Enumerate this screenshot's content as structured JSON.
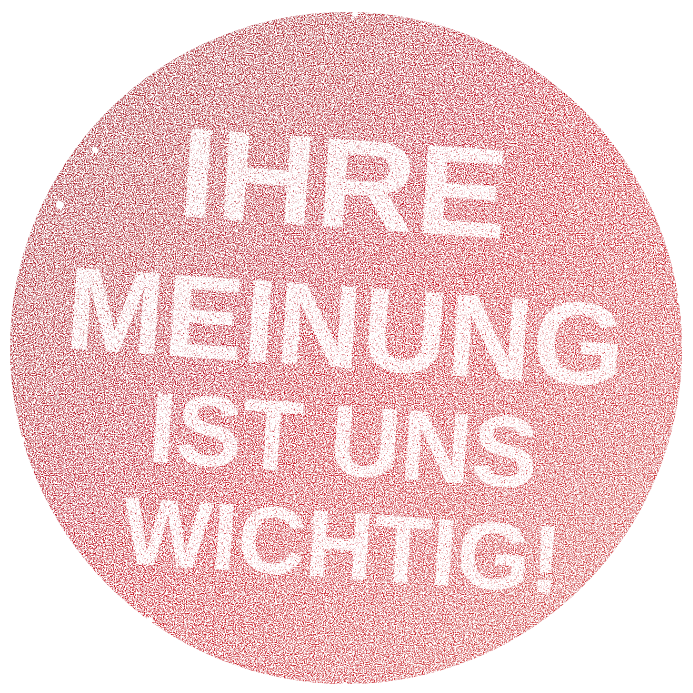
{
  "stamp": {
    "lines": [
      "IHRE",
      "MEINUNG",
      "IST UNS",
      "WICHTIG!"
    ]
  },
  "colors": {
    "stamp_light": "#e01a2c",
    "stamp_mid": "#c8101e",
    "stamp_dark": "#9a1426",
    "stamp_edge": "#d04845",
    "text": "#ffffff",
    "background": "#ffffff"
  }
}
